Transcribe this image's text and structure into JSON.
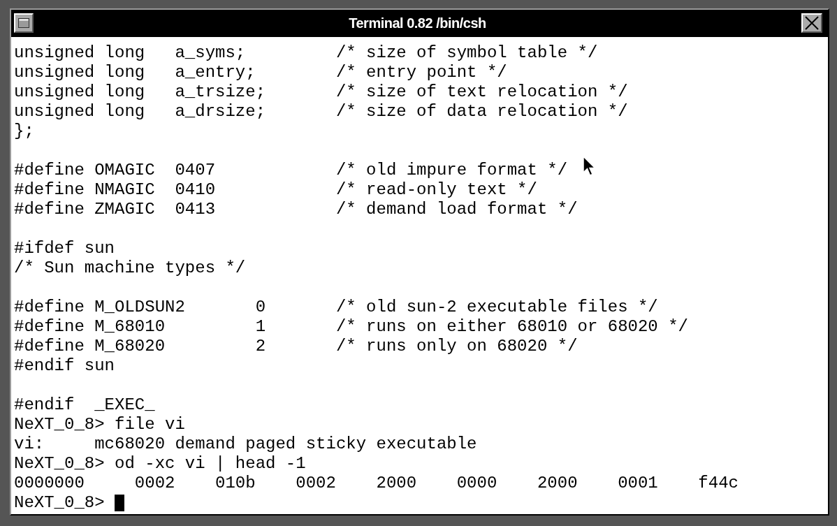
{
  "window": {
    "title": "Terminal 0.82 /bin/csh"
  },
  "terminal": {
    "blocks": [
      [
        "unsigned long   a_syms;         /* size of symbol table */",
        "unsigned long   a_entry;        /* entry point */",
        "unsigned long   a_trsize;       /* size of text relocation */",
        "unsigned long   a_drsize;       /* size of data relocation */",
        "};"
      ],
      [
        "#define OMAGIC  0407            /* old impure format */",
        "#define NMAGIC  0410            /* read-only text */",
        "#define ZMAGIC  0413            /* demand load format */"
      ],
      [
        "#ifdef sun",
        "/* Sun machine types */"
      ],
      [
        "#define M_OLDSUN2       0       /* old sun-2 executable files */",
        "#define M_68010         1       /* runs on either 68010 or 68020 */",
        "#define M_68020         2       /* runs only on 68020 */",
        "#endif sun"
      ],
      [
        "#endif  _EXEC_",
        "NeXT_0_8> file vi",
        "vi:     mc68020 demand paged sticky executable",
        "NeXT_0_8> od -xc vi | head -1",
        "0000000     0002    010b    0002    2000    0000    2000    0001    f44c"
      ]
    ],
    "prompt": "NeXT_0_8>"
  }
}
